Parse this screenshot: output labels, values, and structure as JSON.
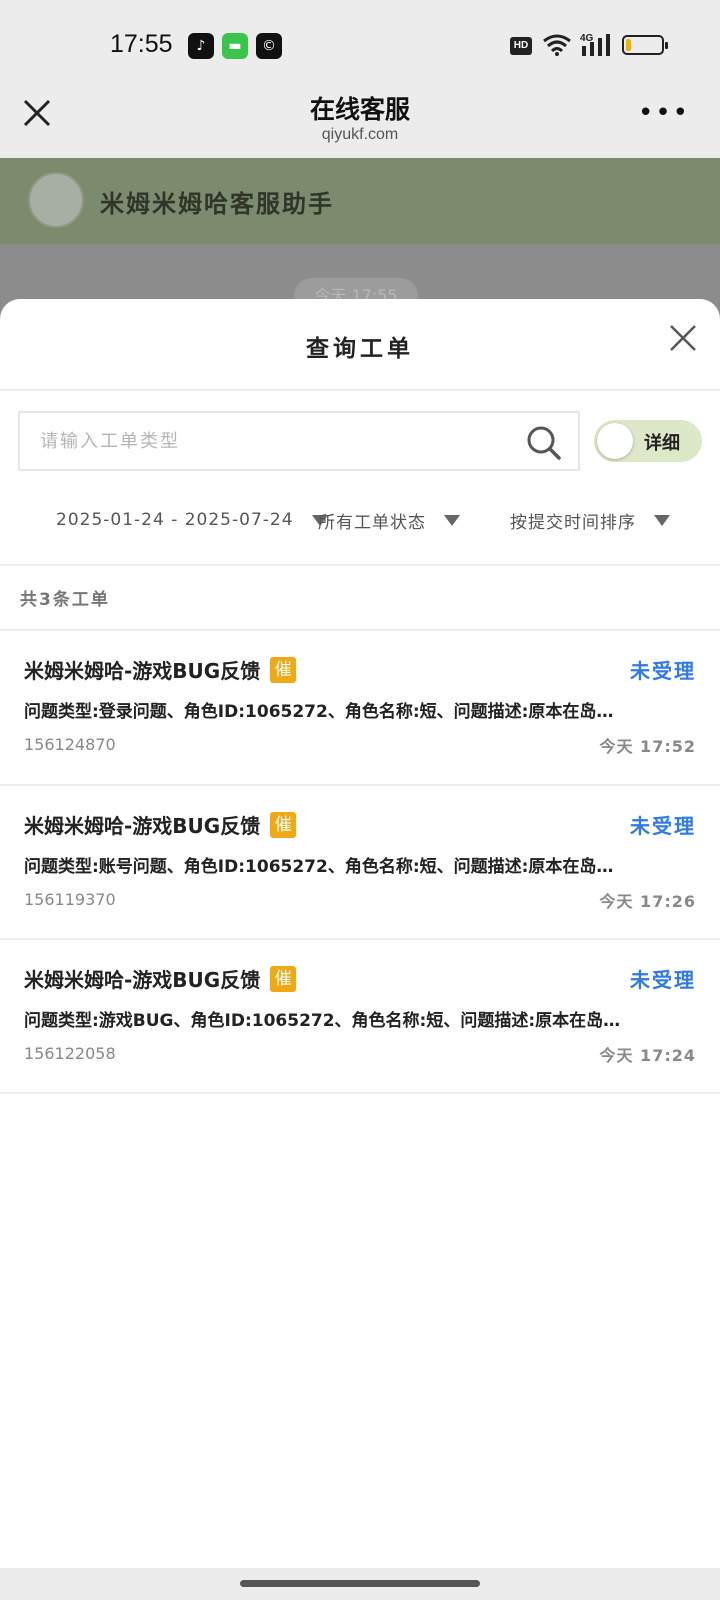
{
  "status_bar": {
    "time": "17:55",
    "hd": "HD",
    "network": "4G",
    "battery_level": 0.15,
    "icons": [
      "tiktok-icon",
      "message-icon",
      "app-icon",
      "wifi-icon",
      "signal-icon",
      "battery-icon"
    ]
  },
  "nav": {
    "title": "在线客服",
    "subtitle": "qiyukf.com",
    "more": "•••"
  },
  "chat": {
    "name": "米姆米姆哈客服助手",
    "date_label": "今天 17:55"
  },
  "sheet": {
    "title": "查询工单",
    "search_placeholder": "请输入工单类型",
    "toggle_label": "详细",
    "filters": {
      "date_range": "2025-01-24 - 2025-07-24",
      "status": "所有工单状态",
      "sort": "按提交时间排序"
    },
    "count": "共3条工单",
    "tickets": [
      {
        "title": "米姆米姆哈-游戏BUG反馈",
        "urge": "催",
        "status": "未受理",
        "desc": "问题类型:登录问题、角色ID:1065272、角色名称:短、问题描述:原本在岛…",
        "id": "156124870",
        "time": "今天 17:52"
      },
      {
        "title": "米姆米姆哈-游戏BUG反馈",
        "urge": "催",
        "status": "未受理",
        "desc": "问题类型:账号问题、角色ID:1065272、角色名称:短、问题描述:原本在岛…",
        "id": "156119370",
        "time": "今天 17:26"
      },
      {
        "title": "米姆米姆哈-游戏BUG反馈",
        "urge": "催",
        "status": "未受理",
        "desc": "问题类型:游戏BUG、角色ID:1065272、角色名称:短、问题描述:原本在岛…",
        "id": "156122058",
        "time": "今天 17:24"
      }
    ]
  },
  "colors": {
    "accent_status": "#2f7ae5",
    "urge_badge": "#f0a814",
    "toggle_bg": "#dce8c7",
    "chat_header": "#7c8b6e"
  }
}
